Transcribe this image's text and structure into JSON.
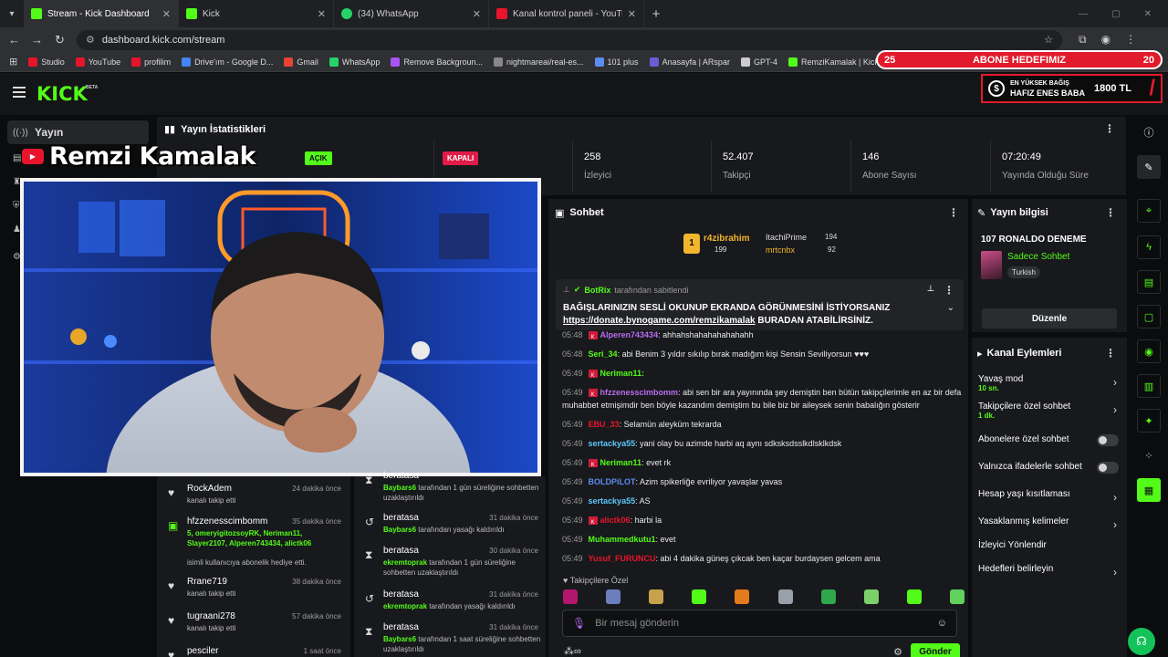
{
  "browser": {
    "tabs": [
      {
        "title": "Stream - Kick Dashboard",
        "color": "#53fc18"
      },
      {
        "title": "Kick",
        "color": "#53fc18"
      },
      {
        "title": "(34) WhatsApp",
        "color": "#25d366"
      },
      {
        "title": "Kanal kontrol paneli - YouTube",
        "color": "#e8142c"
      }
    ],
    "url": "dashboard.kick.com/stream",
    "bookmarks": [
      {
        "label": "Studio",
        "color": "#e8142c"
      },
      {
        "label": "YouTube",
        "color": "#e8142c"
      },
      {
        "label": "profilim",
        "color": "#e8142c"
      },
      {
        "label": "Drive'ım - Google D...",
        "color": "#4285f4"
      },
      {
        "label": "Gmail",
        "color": "#ea4335"
      },
      {
        "label": "WhatsApp",
        "color": "#25d366"
      },
      {
        "label": "Remove Backgroun...",
        "color": "#a855f7"
      },
      {
        "label": "nightmareai/real-es...",
        "color": "#888888"
      },
      {
        "label": "101 plus",
        "color": "#5b8def"
      },
      {
        "label": "Anasayfa | ARspar",
        "color": "#6b5bd6"
      },
      {
        "label": "GPT-4",
        "color": "#cccccc"
      },
      {
        "label": "RemziKamalak | Kick",
        "color": "#53fc18"
      }
    ]
  },
  "header": {
    "logo": "KICK",
    "beta": "BETA",
    "goal": {
      "left": "25",
      "label": "ABONE HEDEFIMIZ",
      "right": "20"
    },
    "donor": {
      "line1": "EN YÜKSEK BAĞIŞ",
      "line2": "HAFIZ ENES BABA",
      "amount": "1800 TL"
    }
  },
  "leftnav": {
    "active": "Yayın"
  },
  "overlay": {
    "streamer_name": "Remzi Kamalak"
  },
  "stats": {
    "title": "Yayın İstatistikleri",
    "badge_on": "AÇIK",
    "badge_off": "KAPALI",
    "items": [
      {
        "value": "258",
        "label": "İzleyici"
      },
      {
        "value": "52.407",
        "label": "Takipçi"
      },
      {
        "value": "146",
        "label": "Abone Sayısı"
      },
      {
        "value": "07:20:49",
        "label": "Yayında Olduğu Süre"
      }
    ]
  },
  "activity": [
    {
      "name": "RockAdem",
      "time": "24 dakika önce",
      "sub": "kanalı takip etti",
      "icon": "heart"
    },
    {
      "name": "hfzzenesscimbomm",
      "time": "35 dakika önce",
      "gift": "5, omeryigitozsoyRK, Neriman11, Slayer2107, Alperen743434, alictk06",
      "sub": "isimli kullanıcıya abonelik hediye etti.",
      "icon": "gift"
    },
    {
      "name": "Rrane719",
      "time": "38 dakika önce",
      "sub": "kanalı takip etti",
      "icon": "heart"
    },
    {
      "name": "tugraani278",
      "time": "57 dakika önce",
      "sub": "kanalı takip etti",
      "icon": "heart"
    },
    {
      "name": "pesciler",
      "time": "1 saat önce",
      "sub": "",
      "icon": "heart"
    }
  ],
  "modlog": [
    {
      "name": "beratasa",
      "time": "",
      "by": "Baybars6",
      "rest": "tarafından 1 gün süreliğine sohbetten uzaklaştırıldı",
      "icon": "hourglass"
    },
    {
      "name": "beratasa",
      "time": "31 dakika önce",
      "by": "Baybars6",
      "rest": "tarafından yasağı kaldırıldı",
      "icon": "undo"
    },
    {
      "name": "beratasa",
      "time": "30 dakika önce",
      "by": "ekremtoprak",
      "rest": "tarafından 1 gün süreliğine sohbetten uzaklaştırıldı",
      "icon": "hourglass"
    },
    {
      "name": "beratasa",
      "time": "31 dakika önce",
      "by": "ekremtoprak",
      "rest": "tarafından yasağı kaldırıldı",
      "icon": "undo"
    },
    {
      "name": "beratasa",
      "time": "31 dakika önce",
      "by": "Baybars6",
      "rest": "tarafından 1 saat süreliğine sohbetten uzaklaştırıldı",
      "icon": "hourglass"
    }
  ],
  "chat": {
    "title": "Sohbet",
    "leaders": [
      {
        "name": "r4zibrahim",
        "count": "199"
      },
      {
        "name": "ItachiPrime",
        "count": "194"
      },
      {
        "name": "mrtcnbx",
        "count": "92"
      }
    ],
    "pinned": {
      "user": "BotRix",
      "by": "tarafından sabitlendi",
      "line1": "BAĞIŞLARINIZIN SESLİ OKUNUP EKRANDA GÖRÜNMESİNİ İSTİYORSANIZ",
      "link": "https://donate.bynogame.com/remzikamalak",
      "line2": "BURADAN ATABİLİRSİNİZ."
    },
    "messages": [
      {
        "time": "05:48",
        "user": "Alperen743434",
        "color": "#b86cf0",
        "text": ": ahhahshahahahahahahh",
        "badge": true
      },
      {
        "time": "05:48",
        "user": "Seri_34",
        "color": "#53fc18",
        "text": ": abi Benim 3 yıldır sıkılıp bırak madığım kişi Sensin Seviliyorsun ♥♥♥",
        "badge": false
      },
      {
        "time": "05:49",
        "user": "Neriman11:",
        "color": "#53fc18",
        "text": "",
        "badge": true
      },
      {
        "time": "05:49",
        "user": "hfzzenesscimbomm",
        "color": "#b86cf0",
        "text": ": abi sen bir ara yayınında şey demiştin ben bütün takipçilerimle en az bir defa muhabbet etmişimdir ben böyle kazandım demiştim bu bile biz bir aileysek senin babalığın gösterir",
        "badge": true
      },
      {
        "time": "05:49",
        "user": "EBU_33",
        "color": "#e8142c",
        "text": ": Selamün aleyküm tekrarda",
        "badge": false
      },
      {
        "time": "05:49",
        "user": "sertackya55",
        "color": "#5bc8ff",
        "text": ": yani olay bu azimde harbi aq aynı sdksksdsslkdlsklkdsk",
        "badge": false
      },
      {
        "time": "05:49",
        "user": "Neriman11",
        "color": "#53fc18",
        "text": ": evet rk",
        "badge": true
      },
      {
        "time": "05:49",
        "user": "BOLDPiLOT",
        "color": "#5b8def",
        "text": ": Azim spikerliğe evriliyor yavaşlar yavas",
        "badge": false
      },
      {
        "time": "05:49",
        "user": "sertackya55",
        "color": "#5bc8ff",
        "text": ": AS",
        "badge": false
      },
      {
        "time": "05:49",
        "user": "alictk06",
        "color": "#e8142c",
        "text": ": harbi la",
        "badge": true
      },
      {
        "time": "05:49",
        "user": "Muhammedkutu1",
        "color": "#53fc18",
        "text": ": evet",
        "badge": false
      },
      {
        "time": "05:49",
        "user": "Yusuf_FURUNCU",
        "color": "#e8142c",
        "text": ": abi 4 dakika güneş çıkcak ben kaçar burdaysen gelcem ama",
        "badge": false
      }
    ],
    "follower_only": "Takipçilere Özel",
    "placeholder": "Bir mesaj gönderin",
    "send": "Gönder"
  },
  "stream_info": {
    "title": "Yayın bilgisi",
    "stream_title": "107 RONALDO DENEME",
    "category": "Sadece Sohbet",
    "language": "Turkish",
    "edit": "Düzenle"
  },
  "channel_actions": {
    "title": "Kanal Eylemleri",
    "rows": [
      {
        "label": "Yavaş mod",
        "sub": "10 sn.",
        "kind": "chevron"
      },
      {
        "label": "Takipçilere özel sohbet",
        "sub": "1 dk.",
        "kind": "chevron"
      },
      {
        "label": "Abonelere özel sohbet",
        "sub": "",
        "kind": "toggle"
      },
      {
        "label": "Yalnızca ifadelerle sohbet",
        "sub": "",
        "kind": "toggle"
      },
      {
        "label": "Hesap yaşı kısıtlaması",
        "sub": "",
        "kind": "chevron"
      },
      {
        "label": "Yasaklanmış kelimeler",
        "sub": "",
        "kind": "chevron"
      },
      {
        "label": "İzleyici Yönlendir",
        "sub": "",
        "kind": "none"
      },
      {
        "label": "Hedefleri belirleyin",
        "sub": "",
        "kind": "chevron"
      }
    ]
  }
}
